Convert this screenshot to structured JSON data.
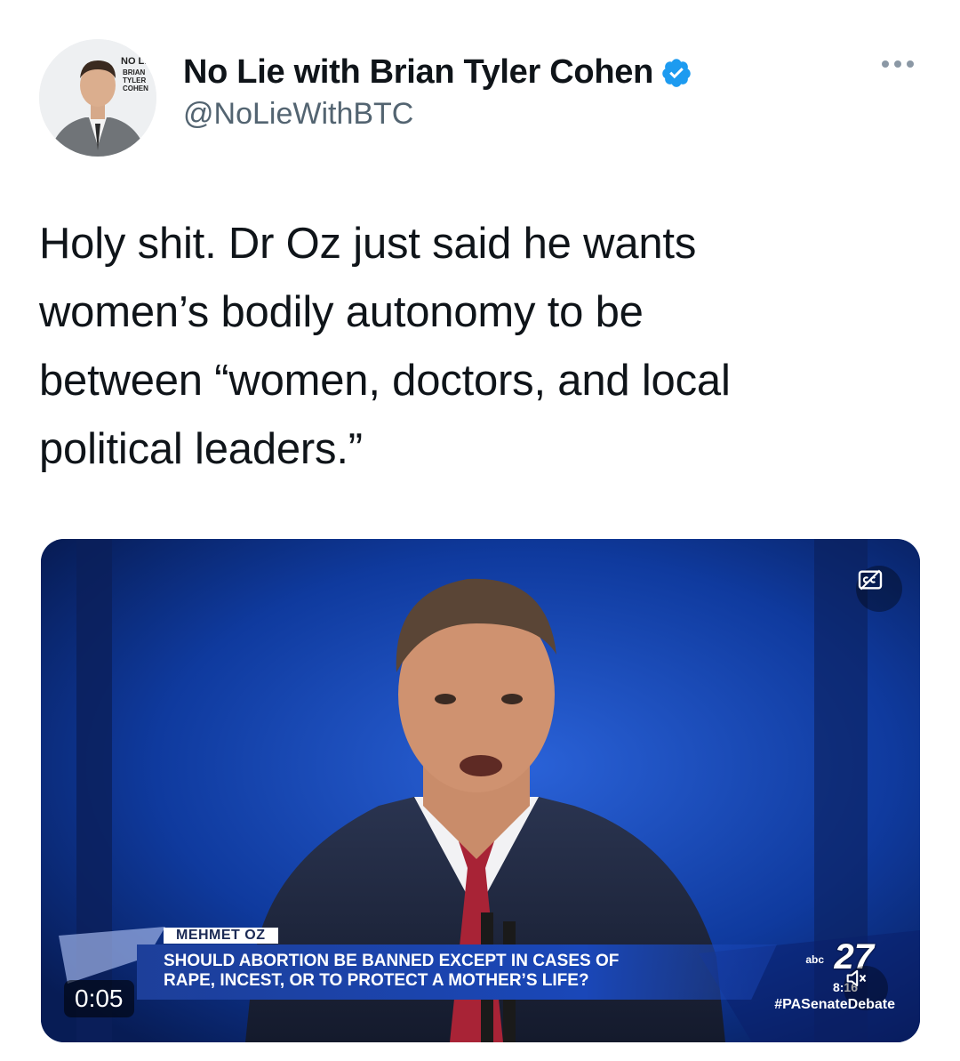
{
  "author": {
    "display_name": "No Lie with Brian Tyler Cohen",
    "handle": "@NoLieWithBTC",
    "avatar_logo_text": "NO LIE with BRIAN TYLER COHEN",
    "verified": true
  },
  "menu_icon": "more-horizontal-icon",
  "tweet": {
    "lines": [
      "Holy shit. Dr Oz just said he wants",
      "women’s bodily autonomy to be",
      "between “women, doctors, and local",
      "political leaders.”"
    ]
  },
  "video": {
    "timer": "0:05",
    "lower_third_name": "MEHMET OZ",
    "question_line1": "SHOULD ABORTION BE BANNED EXCEPT IN CASES OF",
    "question_line2": "RAPE, INCEST, OR TO PROTECT A MOTHER’S LIFE?",
    "station_prefix": "abc",
    "station_number": "27",
    "clock": "8:16",
    "hashtag": "#PASenateDebate",
    "cc_icon": "closed-captions-icon",
    "mute_icon": "speaker-muted-icon"
  },
  "colors": {
    "verified_blue": "#1d9bf0",
    "handle_gray": "#536471",
    "studio_blue": "#0a2a78"
  }
}
